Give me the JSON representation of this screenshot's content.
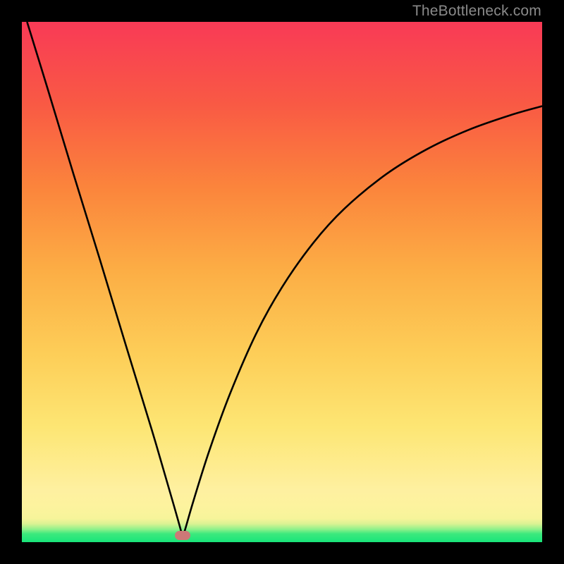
{
  "watermark": "TheBottleneck.com",
  "marker": {
    "x_fraction": 0.309
  },
  "chart_data": {
    "type": "line",
    "title": "",
    "xlabel": "",
    "ylabel": "",
    "xlim": [
      0,
      1
    ],
    "ylim": [
      0,
      1
    ],
    "grid": false,
    "legend": false,
    "series": [
      {
        "name": "bottleneck-curve",
        "x": [
          0.01,
          0.05,
          0.1,
          0.15,
          0.2,
          0.25,
          0.29,
          0.305,
          0.309,
          0.314,
          0.33,
          0.36,
          0.4,
          0.45,
          0.5,
          0.56,
          0.62,
          0.7,
          0.78,
          0.86,
          0.94,
          1.0
        ],
        "y": [
          1.0,
          0.87,
          0.705,
          0.543,
          0.378,
          0.215,
          0.078,
          0.025,
          0.01,
          0.025,
          0.08,
          0.175,
          0.285,
          0.4,
          0.49,
          0.575,
          0.641,
          0.707,
          0.756,
          0.793,
          0.821,
          0.838
        ]
      }
    ],
    "annotations": [
      {
        "type": "marker",
        "shape": "pill",
        "x": 0.309,
        "y": 0.01,
        "color": "#cd7877"
      }
    ],
    "background_gradient": {
      "direction": "vertical",
      "stops": [
        {
          "pos": 0.0,
          "color": "#18e57a"
        },
        {
          "pos": 0.05,
          "color": "#fdf39e"
        },
        {
          "pos": 0.35,
          "color": "#fdce58"
        },
        {
          "pos": 0.65,
          "color": "#fb853c"
        },
        {
          "pos": 1.0,
          "color": "#f93a56"
        }
      ]
    }
  }
}
